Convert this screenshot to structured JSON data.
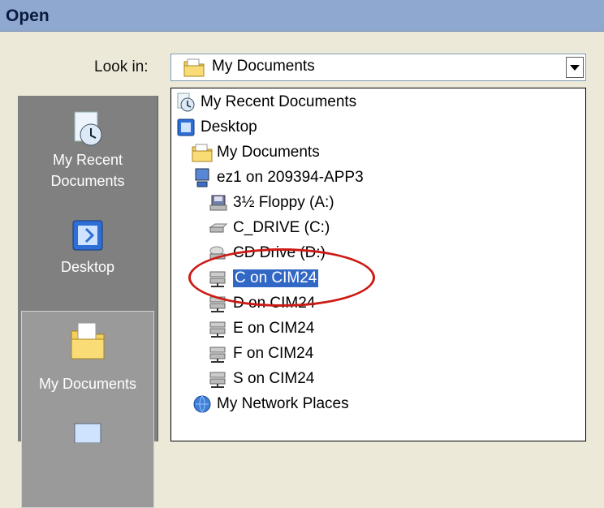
{
  "window": {
    "title": "Open"
  },
  "lookin": {
    "label": "Look in:",
    "value": "My Documents"
  },
  "places_bar": [
    {
      "label": "My Recent Documents",
      "icon": "recent-documents-icon"
    },
    {
      "label": "Desktop",
      "icon": "desktop-icon"
    },
    {
      "label": "My Documents",
      "icon": "my-documents-icon",
      "selected": true
    },
    {
      "label": "",
      "icon": "my-computer-icon"
    }
  ],
  "dropdown_items": [
    {
      "label": "My Recent Documents",
      "icon": "recent-documents-icon",
      "level": 0
    },
    {
      "label": "Desktop",
      "icon": "desktop-icon",
      "level": 0
    },
    {
      "label": "My Documents",
      "icon": "folder-icon",
      "level": 1
    },
    {
      "label": "ez1 on 209394-APP3",
      "icon": "computer-icon",
      "level": 1
    },
    {
      "label": "3½ Floppy (A:)",
      "icon": "floppy-icon",
      "level": 2
    },
    {
      "label": "C_DRIVE (C:)",
      "icon": "hard-drive-icon",
      "level": 2
    },
    {
      "label": "CD Drive (D:)",
      "icon": "cd-drive-icon",
      "level": 2
    },
    {
      "label": "C on CIM24",
      "icon": "network-drive-icon",
      "level": 2,
      "selected": true
    },
    {
      "label": "D on CIM24",
      "icon": "network-drive-icon",
      "level": 2
    },
    {
      "label": "E on CIM24",
      "icon": "network-drive-icon",
      "level": 2
    },
    {
      "label": "F on CIM24",
      "icon": "network-drive-icon",
      "level": 2
    },
    {
      "label": "S on CIM24",
      "icon": "network-drive-icon",
      "level": 2
    },
    {
      "label": "My Network Places",
      "icon": "network-places-icon",
      "level": 1
    }
  ],
  "colors": {
    "highlight": "#3168c6",
    "annotation": "#cc1a14",
    "titlebar": "#8fa8d0"
  }
}
